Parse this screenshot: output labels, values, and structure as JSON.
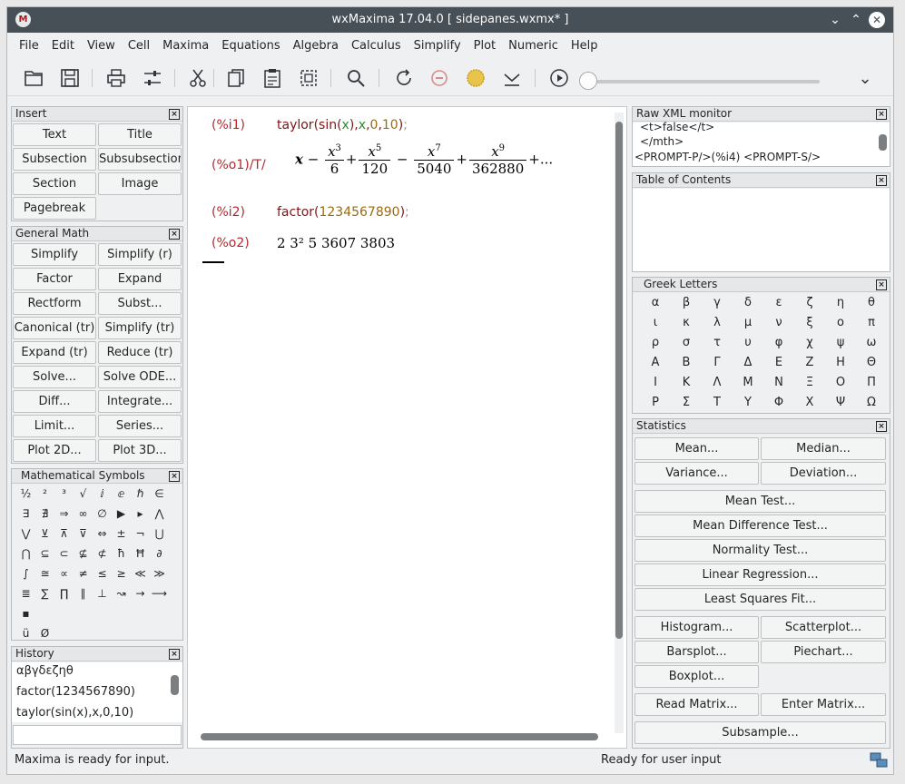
{
  "window": {
    "title": "wxMaxima 17.04.0  [ sidepanes.wxmx* ]",
    "minimize": "⌄",
    "maximize": "⌃",
    "close": "✕"
  },
  "menu": [
    "File",
    "Edit",
    "View",
    "Cell",
    "Maxima",
    "Equations",
    "Algebra",
    "Calculus",
    "Simplify",
    "Plot",
    "Numeric",
    "Help"
  ],
  "toolbar": {
    "icons": [
      "open-icon",
      "save-icon",
      "print-icon",
      "preferences-icon",
      "cut-icon",
      "copy-icon",
      "paste-icon",
      "select-all-icon",
      "find-icon",
      "restart-icon",
      "interrupt-icon",
      "follow-icon",
      "evaluate-icon",
      "play-icon"
    ],
    "more": "⌄"
  },
  "insert": {
    "title": "Insert",
    "buttons": [
      "Text",
      "Title",
      "Subsection",
      "Subsubsection",
      "Section",
      "Image",
      "Pagebreak"
    ]
  },
  "general_math": {
    "title": "General Math",
    "buttons": [
      "Simplify",
      "Simplify (r)",
      "Factor",
      "Expand",
      "Rectform",
      "Subst...",
      "Canonical (tr)",
      "Simplify (tr)",
      "Expand (tr)",
      "Reduce (tr)",
      "Solve...",
      "Solve ODE...",
      "Diff...",
      "Integrate...",
      "Limit...",
      "Series...",
      "Plot 2D...",
      "Plot 3D..."
    ]
  },
  "math_symbols": {
    "title": "Mathematical Symbols",
    "rows": [
      [
        "½",
        "²",
        "³",
        "√",
        "ⅈ",
        "ⅇ",
        "ℏ",
        "∈"
      ],
      [
        "∃",
        "∄",
        "⇒",
        "∞",
        "∅",
        "▶",
        "▸",
        "⋀"
      ],
      [
        "⋁",
        "⊻",
        "⊼",
        "⊽",
        "⇔",
        "±",
        "¬",
        "⋃"
      ],
      [
        "⋂",
        "⊆",
        "⊂",
        "⊈",
        "⊄",
        "ħ",
        "Ħ",
        "∂"
      ],
      [
        "∫",
        "≅",
        "∝",
        "≠",
        "≤",
        "≥",
        "≪",
        "≫"
      ],
      [
        "≣",
        "∑",
        "∏",
        "∥",
        "⊥",
        "↝",
        "→",
        "⟶"
      ],
      [
        "▪"
      ],
      [
        "ü",
        "Ø"
      ]
    ]
  },
  "history": {
    "title": "History",
    "items": [
      "αβγδεζηθ",
      "factor(1234567890)",
      "taylor(sin(x),x,0,10)"
    ]
  },
  "worksheet": {
    "i1_label": "(%i1)",
    "o1_label": "(%o1)/T/",
    "i2_label": "(%i2)",
    "o2_label": "(%o2)",
    "i2_func": "factor(",
    "i2_num": "1234567890",
    "i2_close": ")",
    "i2_semi": ";",
    "o2_text": "2 3² 5 3607 3803"
  },
  "raw_xml": {
    "title": "Raw XML monitor",
    "lines": [
      "<t>false</t>",
      "</mth>",
      "<PROMPT-P/>(%i4) <PROMPT-S/>"
    ]
  },
  "toc": {
    "title": "Table of Contents"
  },
  "greek": {
    "title": "Greek Letters",
    "rows": [
      [
        "α",
        "β",
        "γ",
        "δ",
        "ε",
        "ζ",
        "η",
        "θ"
      ],
      [
        "ι",
        "κ",
        "λ",
        "μ",
        "ν",
        "ξ",
        "ο",
        "π"
      ],
      [
        "ρ",
        "σ",
        "τ",
        "υ",
        "φ",
        "χ",
        "ψ",
        "ω"
      ],
      [
        "Α",
        "Β",
        "Γ",
        "Δ",
        "Ε",
        "Ζ",
        "Η",
        "Θ"
      ],
      [
        "Ι",
        "Κ",
        "Λ",
        "Μ",
        "Ν",
        "Ξ",
        "Ο",
        "Π"
      ],
      [
        "Ρ",
        "Σ",
        "Τ",
        "Υ",
        "Φ",
        "Χ",
        "Ψ",
        "Ω"
      ]
    ]
  },
  "statistics": {
    "title": "Statistics",
    "pair1": [
      "Mean...",
      "Median...",
      "Variance...",
      "Deviation..."
    ],
    "singles": [
      "Mean Test...",
      "Mean Difference Test...",
      "Normality Test...",
      "Linear Regression...",
      "Least Squares Fit..."
    ],
    "pair2": [
      "Histogram...",
      "Scatterplot...",
      "Barsplot...",
      "Piechart...",
      "Boxplot..."
    ],
    "pair3": [
      "Read Matrix...",
      "Enter Matrix..."
    ],
    "subsample": "Subsample..."
  },
  "status": {
    "left": "Maxima is ready for input.",
    "right": "Ready for user input"
  }
}
